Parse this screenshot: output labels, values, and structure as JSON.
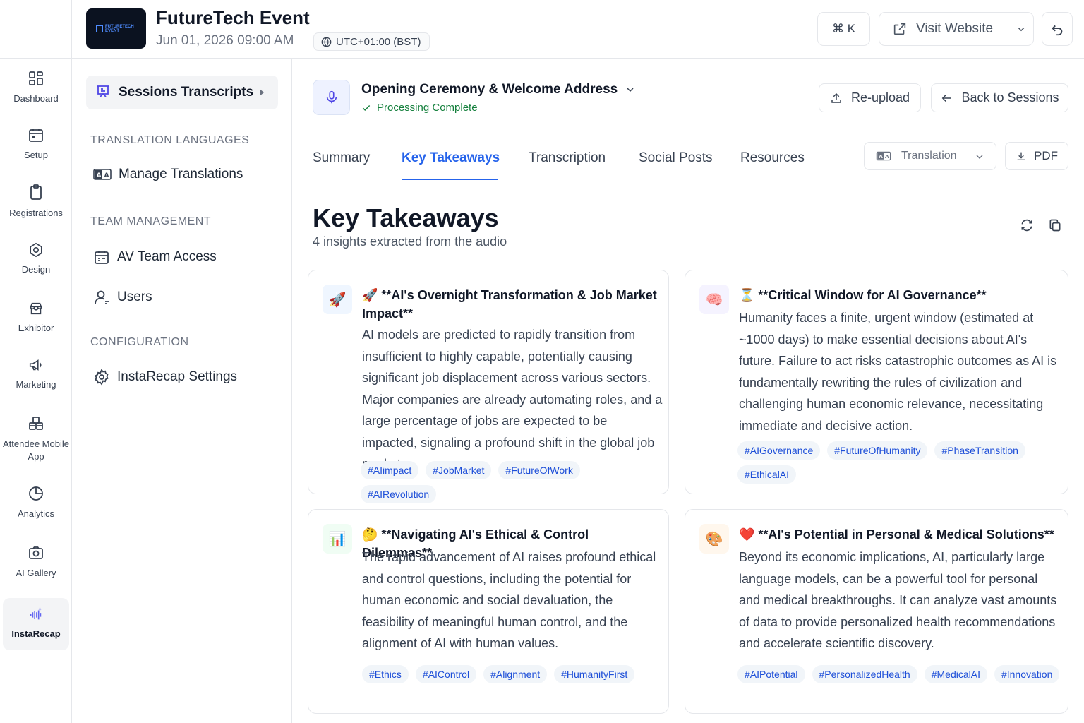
{
  "header": {
    "logo_text": "FUTURETECH EVENT",
    "event_title": "FutureTech Event",
    "event_date": "Jun 01, 2026 09:00 AM",
    "timezone": "UTC+01:00 (BST)",
    "command_shortcut": "⌘ K",
    "visit_website": "Visit Website"
  },
  "rail": {
    "items": [
      {
        "label": "Dashboard",
        "icon": "grid-icon"
      },
      {
        "label": "Setup",
        "icon": "calendar-icon"
      },
      {
        "label": "Registrations",
        "icon": "clipboard-icon"
      },
      {
        "label": "Design",
        "icon": "gear-icon"
      },
      {
        "label": "Exhibitor",
        "icon": "store-icon"
      },
      {
        "label": "Marketing",
        "icon": "megaphone-icon"
      },
      {
        "label": "Attendee Mobile App",
        "icon": "apps-icon"
      },
      {
        "label": "Analytics",
        "icon": "pie-chart-icon"
      },
      {
        "label": "AI Gallery",
        "icon": "camera-icon"
      },
      {
        "label": "InstaRecap",
        "icon": "audio-wave-icon"
      }
    ]
  },
  "panel": {
    "active_item": "Sessions Transcripts",
    "section_translation": "TRANSLATION LANGUAGES",
    "manage_translations": "Manage Translations",
    "section_team": "TEAM MANAGEMENT",
    "av_team_access": "AV Team Access",
    "users": "Users",
    "section_config": "CONFIGURATION",
    "instarecap_settings": "InstaRecap Settings"
  },
  "session": {
    "title": "Opening Ceremony & Welcome Address",
    "status": "Processing Complete",
    "reupload": "Re-upload",
    "back": "Back to Sessions"
  },
  "tabs": [
    "Summary",
    "Key Takeaways",
    "Transcription",
    "Social Posts",
    "Resources"
  ],
  "translation_select": "Translation",
  "pdf_label": "PDF",
  "content": {
    "title": "Key Takeaways",
    "subtitle": "4 insights extracted from the audio"
  },
  "cards": [
    {
      "icon": "🚀",
      "icon_bg": "#eff6ff",
      "title": "🚀 **AI's Overnight Transformation & Job Market Impact**",
      "body": "AI models are predicted to rapidly transition from insufficient to highly capable, potentially causing significant job displacement across various sectors. Major companies are already automating roles, and a large percentage of jobs are expected to be impacted, signaling a profound shift in the global job market.",
      "tags": [
        "#AIimpact",
        "#JobMarket",
        "#FutureOfWork",
        "#AIRevolution"
      ]
    },
    {
      "icon": "🧠",
      "icon_bg": "#f5f3ff",
      "title": "⏳ **Critical Window for AI Governance**",
      "body": "Humanity faces a finite, urgent window (estimated at ~1000 days) to make essential decisions about AI's future. Failure to act risks catastrophic outcomes as AI is fundamentally rewriting the rules of civilization and challenging human economic relevance, necessitating immediate and decisive action.",
      "tags": [
        "#AIGovernance",
        "#FutureOfHumanity",
        "#PhaseTransition",
        "#EthicalAI"
      ]
    },
    {
      "icon": "📊",
      "icon_bg": "#f0fdf4",
      "title": "🤔 **Navigating AI's Ethical & Control Dilemmas**",
      "body": "The rapid advancement of AI raises profound ethical and control questions, including the potential for human economic and social devaluation, the feasibility of meaningful human control, and the alignment of AI with human values.",
      "tags": [
        "#Ethics",
        "#AIControl",
        "#Alignment",
        "#HumanityFirst"
      ]
    },
    {
      "icon": "🎨",
      "icon_bg": "#fff7ed",
      "title": "❤️ **AI's Potential in Personal & Medical Solutions**",
      "body": "Beyond its economic implications, AI, particularly large language models, can be a powerful tool for personal and medical breakthroughs. It can analyze vast amounts of data to provide personalized health recommendations and accelerate scientific discovery.",
      "tags": [
        "#AIPotential",
        "#PersonalizedHealth",
        "#MedicalAI",
        "#Innovation"
      ]
    }
  ]
}
